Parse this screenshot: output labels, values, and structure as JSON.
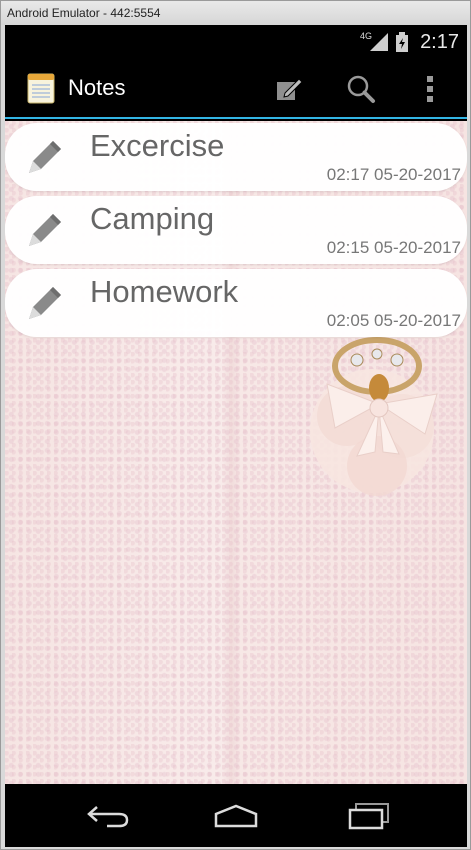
{
  "window": {
    "title": "Android Emulator - 442:5554"
  },
  "status_bar": {
    "network": "4G",
    "time": "2:17"
  },
  "action_bar": {
    "app_title": "Notes",
    "icons": [
      "notes-app-icon",
      "new-note-icon",
      "search-icon",
      "overflow-menu-icon"
    ]
  },
  "notes": [
    {
      "title": "Excercise",
      "timestamp": "02:17 05-20-2017"
    },
    {
      "title": "Camping",
      "timestamp": "02:15 05-20-2017"
    },
    {
      "title": "Homework",
      "timestamp": "02:05 05-20-2017"
    }
  ],
  "nav_bar": {
    "icons": [
      "back-icon",
      "home-icon",
      "recent-apps-icon"
    ]
  },
  "colors": {
    "accent": "#33b5e5",
    "note_text": "#666666"
  }
}
